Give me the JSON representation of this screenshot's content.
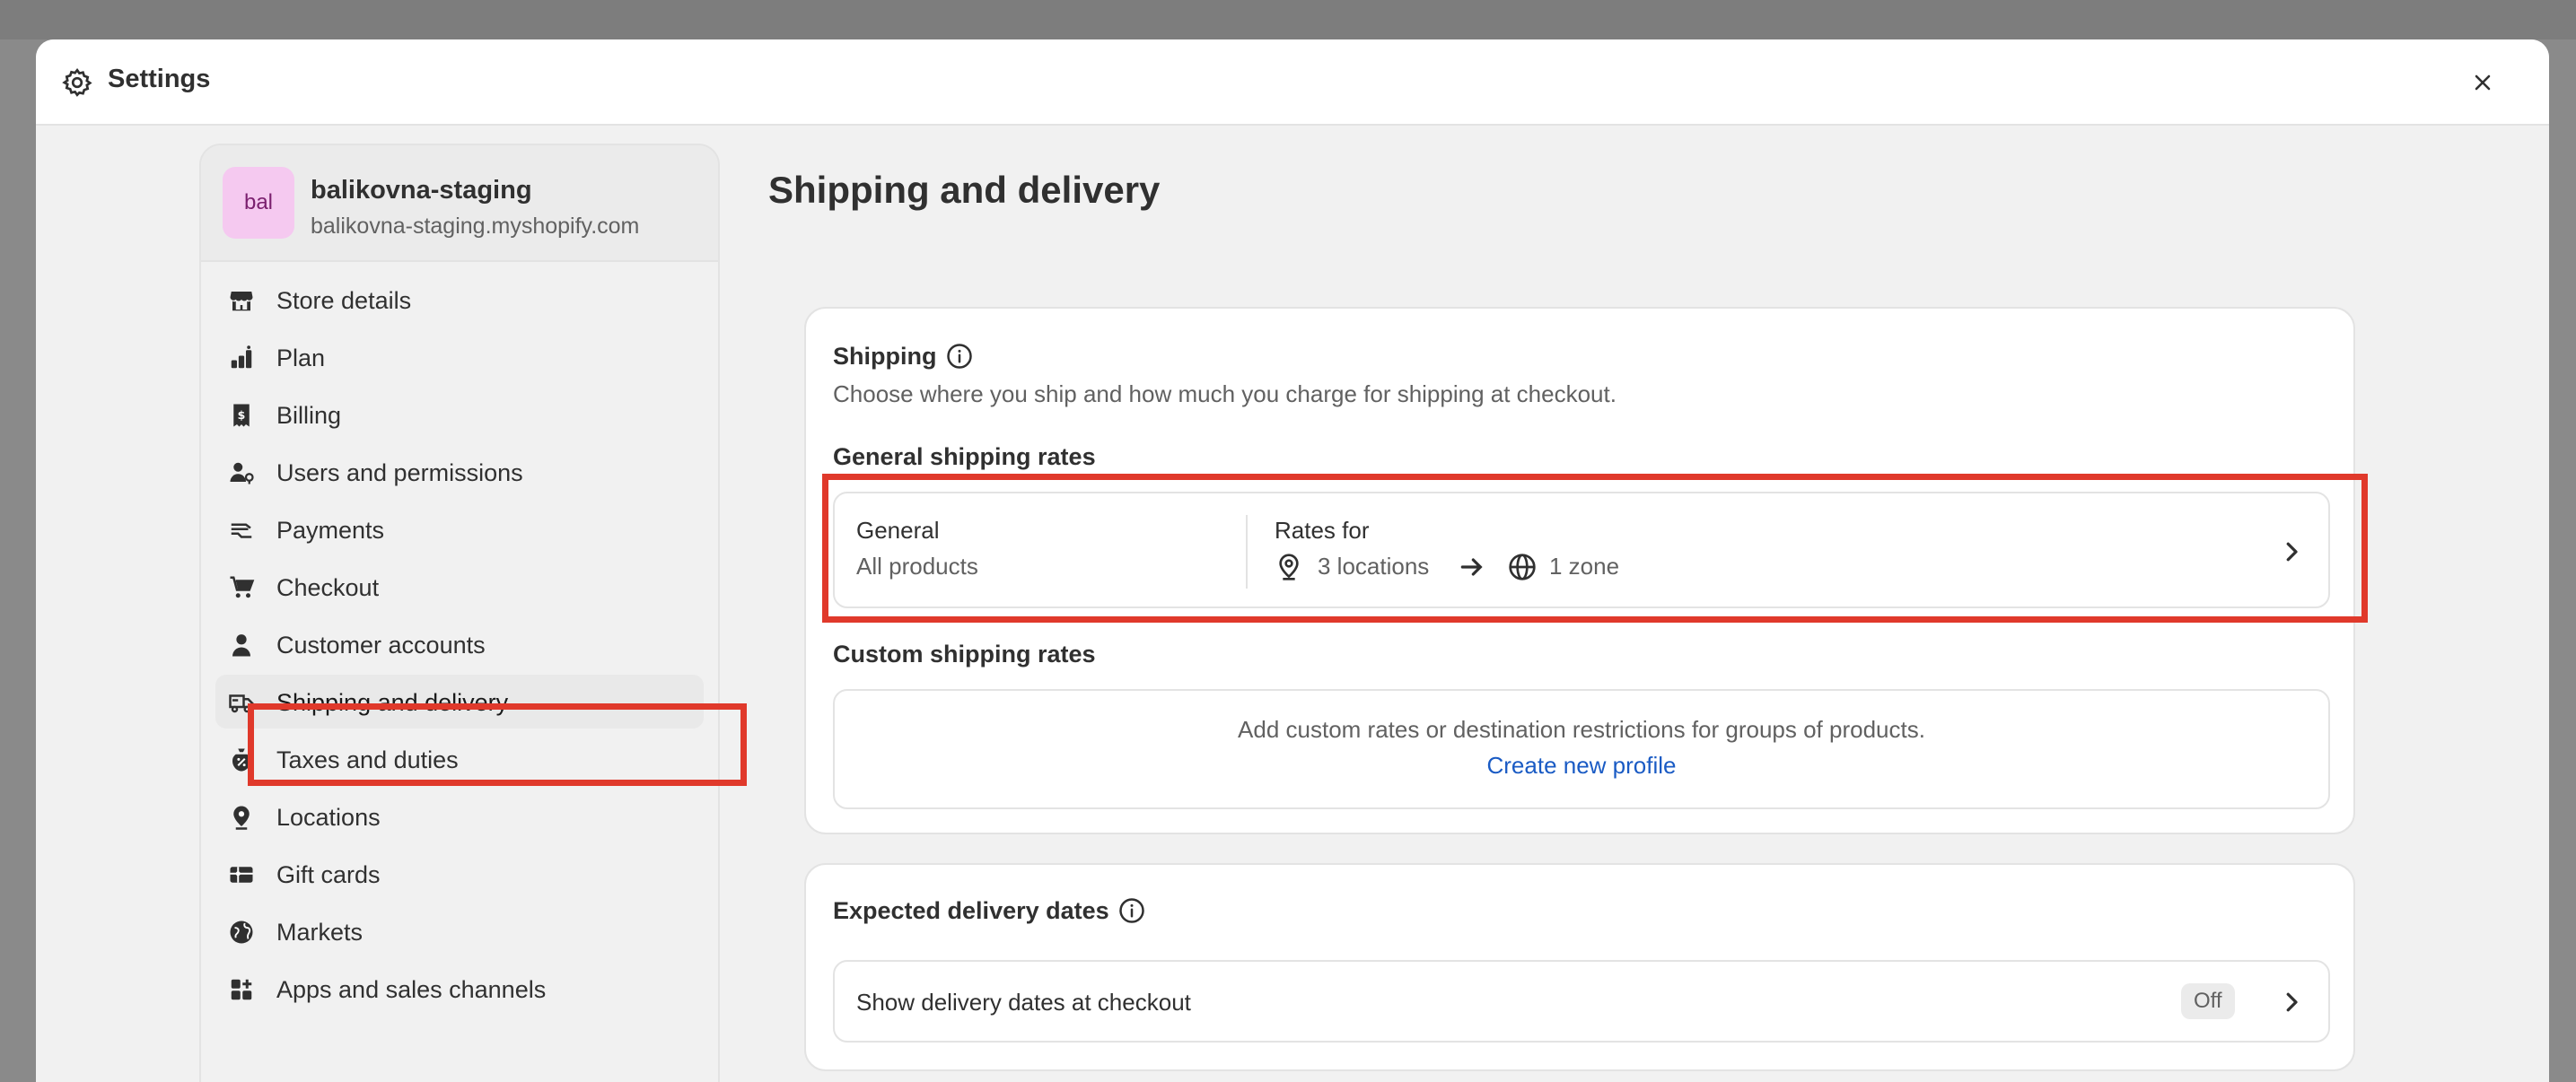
{
  "window": {
    "title": "Settings"
  },
  "store": {
    "avatar_text": "bal",
    "name": "balikovna-staging",
    "domain": "balikovna-staging.myshopify.com"
  },
  "sidebar": {
    "items": [
      {
        "label": "Store details",
        "icon": "store-icon"
      },
      {
        "label": "Plan",
        "icon": "plan-icon"
      },
      {
        "label": "Billing",
        "icon": "billing-icon"
      },
      {
        "label": "Users and permissions",
        "icon": "users-icon"
      },
      {
        "label": "Payments",
        "icon": "payments-icon"
      },
      {
        "label": "Checkout",
        "icon": "cart-icon"
      },
      {
        "label": "Customer accounts",
        "icon": "person-icon"
      },
      {
        "label": "Shipping and delivery",
        "icon": "truck-icon",
        "active": true
      },
      {
        "label": "Taxes and duties",
        "icon": "taxes-icon"
      },
      {
        "label": "Locations",
        "icon": "location-icon"
      },
      {
        "label": "Gift cards",
        "icon": "gift-card-icon"
      },
      {
        "label": "Markets",
        "icon": "globe-icon"
      },
      {
        "label": "Apps and sales channels",
        "icon": "apps-icon"
      }
    ]
  },
  "main": {
    "page_title": "Shipping and delivery",
    "shipping": {
      "title": "Shipping",
      "description": "Choose where you ship and how much you charge for shipping at checkout.",
      "general_rates_title": "General shipping rates",
      "general_profile": {
        "name": "General",
        "scope": "All products",
        "rates_label": "Rates for",
        "locations": "3 locations",
        "zones": "1 zone"
      },
      "custom_rates_title": "Custom shipping rates",
      "custom_rates_desc": "Add custom rates or destination restrictions for groups of products.",
      "create_profile_link": "Create new profile"
    },
    "delivery_dates": {
      "title": "Expected delivery dates",
      "row_label": "Show delivery dates at checkout",
      "status": "Off"
    }
  },
  "colors": {
    "highlight": "#e0392b",
    "link": "#1a5bc4",
    "avatar_bg": "#f5c9f0"
  }
}
